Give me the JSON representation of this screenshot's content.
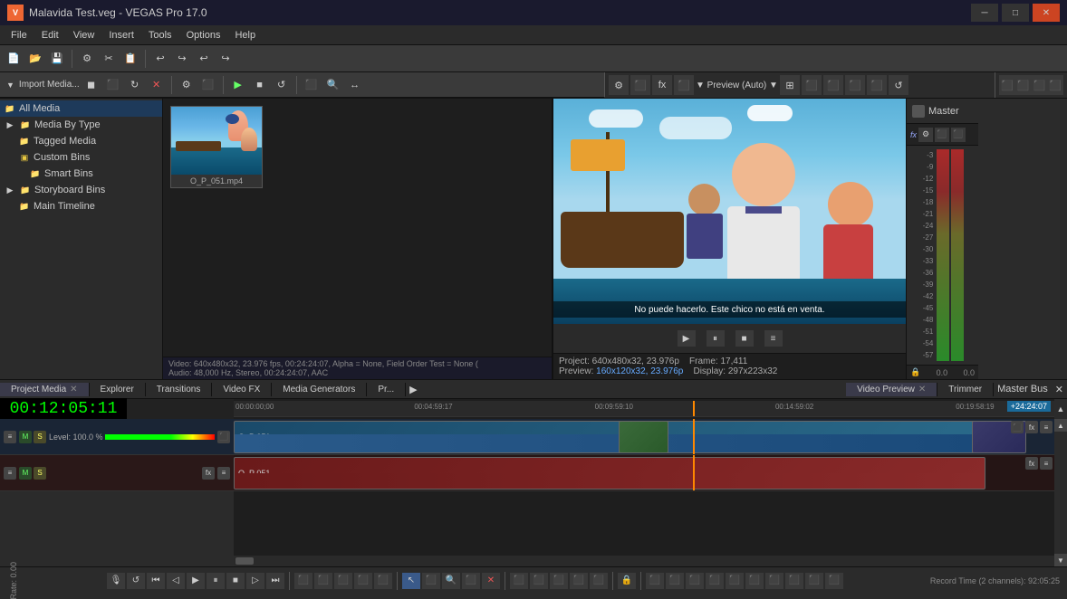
{
  "app": {
    "title": "Malavida Test.veg - VEGAS Pro 17.0",
    "logo": "V"
  },
  "titlebar": {
    "title": "Malavida Test.veg - VEGAS Pro 17.0",
    "minimize": "─",
    "maximize": "□",
    "close": "✕"
  },
  "menu": {
    "items": [
      "File",
      "Edit",
      "View",
      "Insert",
      "Tools",
      "Options",
      "Help"
    ]
  },
  "left_panel": {
    "tree": [
      {
        "label": "All Media",
        "level": 0,
        "selected": true,
        "icon": "folder"
      },
      {
        "label": "Media By Type",
        "level": 0,
        "icon": "folder"
      },
      {
        "label": "Tagged Media",
        "level": 1,
        "icon": "folder"
      },
      {
        "label": "Custom Bins",
        "level": 1,
        "icon": "folder"
      },
      {
        "label": "Smart Bins",
        "level": 2,
        "icon": "folder"
      },
      {
        "label": "Storyboard Bins",
        "level": 0,
        "icon": "folder"
      },
      {
        "label": "Main Timeline",
        "level": 1,
        "icon": "folder-yellow"
      }
    ]
  },
  "media": {
    "header_label": "Import Media...",
    "file": {
      "name": "O_P_051.mp4",
      "label": "O_P_051.mp4"
    }
  },
  "preview": {
    "title": "Preview (Auto)",
    "subtitle": "No puede hacerlo. Este chico no está en venta.",
    "project_info": "Project: 640x480x32, 23.976p",
    "frame_label": "Frame:",
    "frame_value": "17,411",
    "preview_res_label": "Preview:",
    "preview_res": "160x120x32, 23.976p",
    "display_label": "Display:",
    "display_value": "297x223x32"
  },
  "master": {
    "label": "Master",
    "scale": [
      "-3",
      "-9",
      "-12",
      "-15",
      "-18",
      "-21",
      "-24",
      "-27",
      "-30",
      "-33",
      "-36",
      "-39",
      "-42",
      "-45",
      "-48",
      "-51",
      "-54",
      "-57"
    ]
  },
  "bottom_tabs": {
    "tabs": [
      {
        "label": "Project Media",
        "active": true,
        "closeable": true
      },
      {
        "label": "Explorer",
        "active": false,
        "closeable": false
      },
      {
        "label": "Transitions",
        "active": false,
        "closeable": false
      },
      {
        "label": "Video FX",
        "active": false,
        "closeable": false
      },
      {
        "label": "Media Generators",
        "active": false,
        "closeable": false
      },
      {
        "label": "Pr...",
        "active": false,
        "closeable": false
      }
    ],
    "right_tabs": [
      {
        "label": "Video Preview",
        "active": true,
        "closeable": true
      },
      {
        "label": "Trimmer",
        "active": false,
        "closeable": false
      }
    ]
  },
  "timeline": {
    "time_display": "00:12:05:11",
    "total_time": "+24:24:07",
    "ruler_marks": [
      "00:00:00;00",
      "00:04:59:17",
      "00:09:59:10",
      "00:14:59:02",
      "00:19:58:19"
    ],
    "tracks": [
      {
        "name": "O_P 051",
        "type": "video",
        "level": "Level: 100.0 %",
        "clip_label": "O_P 051",
        "clip_start": 0,
        "clip_width": 830
      },
      {
        "name": "O_P 051",
        "type": "audio",
        "clip_label": "O_P 051",
        "clip_start": 0,
        "clip_width": 830
      }
    ]
  },
  "info_bar": {
    "video_info": "Video: 640x480x32, 23.976 fps, 00:24:24:07, Alpha = None, Field Order Test = None (",
    "audio_info": "Audio: 48,000 Hz, Stereo, 00:24:24:07, AAC"
  },
  "playback": {
    "buttons": [
      "⏮",
      "↺",
      "⏪",
      "◁",
      "▶",
      "⏸",
      "■",
      "⏩",
      "▷",
      "⏭",
      "⬛",
      "⬛",
      "⬛",
      "⬛",
      "⬛",
      "⬛",
      "⬛",
      "🔒",
      "⬛",
      "⬛",
      "⬛",
      "⬛",
      "⬛",
      "⬛",
      "⬛",
      "⬛",
      "⬛"
    ]
  },
  "status": {
    "rate": "Rate: 0.00",
    "record_time": "Record Time (2 channels): 92:05:25"
  },
  "master_bus": {
    "label": "Master Bus"
  }
}
